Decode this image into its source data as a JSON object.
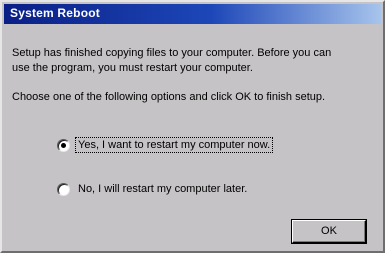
{
  "window": {
    "title": "System Reboot"
  },
  "message": {
    "line1": "Setup has finished copying files to your computer.  Before you can",
    "line2": "use the program, you must restart your computer.",
    "line3": "Choose one of the following options and click OK to finish setup."
  },
  "options": [
    {
      "label": "Yes, I want to restart my computer now.",
      "selected": true
    },
    {
      "label": "No, I will restart my computer later.",
      "selected": false
    }
  ],
  "buttons": {
    "ok_label": "OK"
  },
  "colors": {
    "titlebar_start": "#0a1f86",
    "titlebar_end": "#a7c4ec",
    "dialog_face": "#c6c3c6"
  }
}
